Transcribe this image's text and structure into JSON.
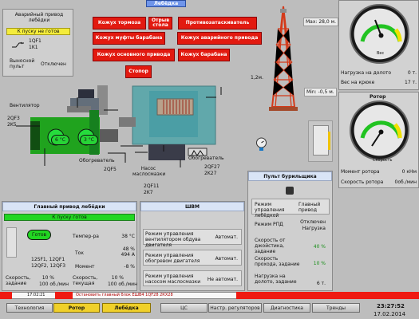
{
  "top_right_cam": {
    "title": "Лебёдка"
  },
  "alarms": {
    "brake": "Кожух тормоза",
    "otbor": "Отрыв стола",
    "drum_clutch": "Кожух муфты барабана",
    "anti_overrun": "Противозатаскиватель",
    "main_drive": "Кожух основного привода",
    "emergency_drive": "Кожух аварийного привода",
    "drum": "Кожух барабана",
    "stop": "Стопор"
  },
  "left_alarm": {
    "title": "Аварийный привод лебёдки",
    "status": "К пуску не готов",
    "code1": "1QF1",
    "code2": "1K1",
    "remote_label": "Выносной пульт",
    "remote_state": "Отключен"
  },
  "mast": {
    "max_label": "Max: 28,0 м.",
    "mid_label": "1,2м.",
    "min_label": "Min: -0,5 м."
  },
  "equipment": {
    "fan": "Вентилятор",
    "fan_code1": "2QF3",
    "fan_code2": "2K5",
    "temp1": "6 °C",
    "temp2": "3 °C",
    "heater1": "Обогреватель",
    "heater1_code": "2QF5",
    "oil_pump": "Насос маслосмазки",
    "oil_code1": "2QF11",
    "oil_code2": "2K7",
    "heater2": "Обогреватель",
    "heater2_code1": "2QF27",
    "heater2_code2": "2K27"
  },
  "hook_gauge": {
    "title": "",
    "scale_label": "Вес",
    "drill_load_label": "Нагрузка на долото",
    "drill_load_value": "0 т.",
    "hook_weight_label": "Вес на крюке",
    "hook_weight_value": "17 т."
  },
  "rotor_gauge": {
    "title": "Ротор",
    "scale_label": "Скорость",
    "moment_label": "Момент ротора",
    "moment_value": "0 кНм",
    "speed_label": "Скорость ротора",
    "speed_value": "0об./мин"
  },
  "main_drive": {
    "title": "Главный привод лебёдки",
    "status": "К пуску готов",
    "go_label": "Готов",
    "temp_label": "Темпер-ра",
    "temp_value": "38 °C",
    "current_label": "Ток",
    "current_value1": "48 %",
    "current_value2": "494 A",
    "moment_label": "Момент",
    "moment_value": "-8 %",
    "codes": "12SF1, 12QF1",
    "codes2": "12QF2, 12QF3",
    "speed_set_label": "Скорость, задание",
    "speed_set_value1": "10 %",
    "speed_set_value2": "100 об./мин",
    "speed_cur_label": "Скорость, текущая",
    "speed_cur_value1": "10 %",
    "speed_cur_value2": "100 об./мин"
  },
  "shvm": {
    "title": "ШВМ",
    "fan_mode_label": "Режим управления вентилятором обдува двигателя",
    "fan_mode_value": "Автомат.",
    "heater_mode_label": "Режим управления обогревом двигателя",
    "heater_mode_value": "Автомат.",
    "oil_mode_label": "Режим управления насосом маслосмазки",
    "oil_mode_value": "Не автомат."
  },
  "driller_panel": {
    "title": "Пульт бурильщика",
    "winch_mode_label": "Режим управления лебёдкой",
    "winch_mode_value": "Главный привод",
    "rpd_mode_label": "Режим РПД",
    "rpd_mode_value1": "Отключен",
    "rpd_mode_value2": "Нагрузка",
    "joy_speed_label": "Скорость от джойстика, задание",
    "joy_speed_value": "40 %",
    "pass_speed_label": "Скорость прохода, задание",
    "pass_speed_value": "10 %",
    "drill_task_label": "Нагрузка на долото, задание",
    "drill_task_value": "6 т."
  },
  "status_bar": {
    "cell1": "",
    "cell2": "17:02:21",
    "cell3": "",
    "message": "Остановить главный блок ЕШВ4 1QF28 2КХ28"
  },
  "nav": {
    "buttons": [
      {
        "label": "Технология"
      },
      {
        "label": "Ротор"
      },
      {
        "label": "Лебёдка"
      },
      {
        "label": "ЦС"
      },
      {
        "label": "Настр. регуляторов"
      },
      {
        "label": "Диагностика"
      },
      {
        "label": "Тренды"
      }
    ],
    "time": "23:27:52",
    "date": "17.02.2014"
  },
  "colors": {
    "alarm": "#e21a10",
    "ok": "#22d622",
    "warning": "#f4ec3b",
    "active_tab": "#f0d02a"
  }
}
